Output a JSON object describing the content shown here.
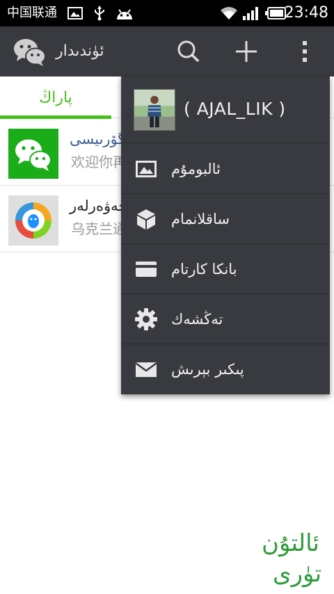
{
  "status_bar": {
    "carrier": "中国联通",
    "time": "23:48"
  },
  "action_bar": {
    "title": "ئۈندىدار",
    "logo_icon": "wechat-logo-icon",
    "search_icon": "search-icon",
    "add_icon": "plus-icon",
    "more_icon": "overflow-menu-icon"
  },
  "tabs": [
    {
      "label": "پاراڭ",
      "active": true
    }
  ],
  "chats": [
    {
      "name": "گۆرىيسى",
      "message": "欢迎你再",
      "avatar_icon": "wechat-team-avatar",
      "name_color": "#3b5d8f"
    },
    {
      "name": "خەۋەرلەر",
      "message": "乌克兰通",
      "avatar_icon": "qq-news-avatar",
      "name_color": "#222222"
    }
  ],
  "menu": {
    "username": "( AJAL_LIK )",
    "items": [
      {
        "label": "ئالبومۇم",
        "icon": "photo-album-icon"
      },
      {
        "label": "ساقلانمام",
        "icon": "favorites-box-icon"
      },
      {
        "label": "بانكا كارتام",
        "icon": "bank-card-icon"
      },
      {
        "label": "تەڭشەك",
        "icon": "settings-gear-icon"
      },
      {
        "label": "پىكىر بېرىش",
        "icon": "feedback-mail-icon"
      }
    ]
  },
  "colors": {
    "accent_green": "#45c01a",
    "action_bar": "#393a3f",
    "menu_bg": "#393a3f",
    "status_bar": "#000000"
  },
  "watermark": {
    "text": "ئالتۇن تۈرى",
    "icon": "calligraphy-logo"
  }
}
